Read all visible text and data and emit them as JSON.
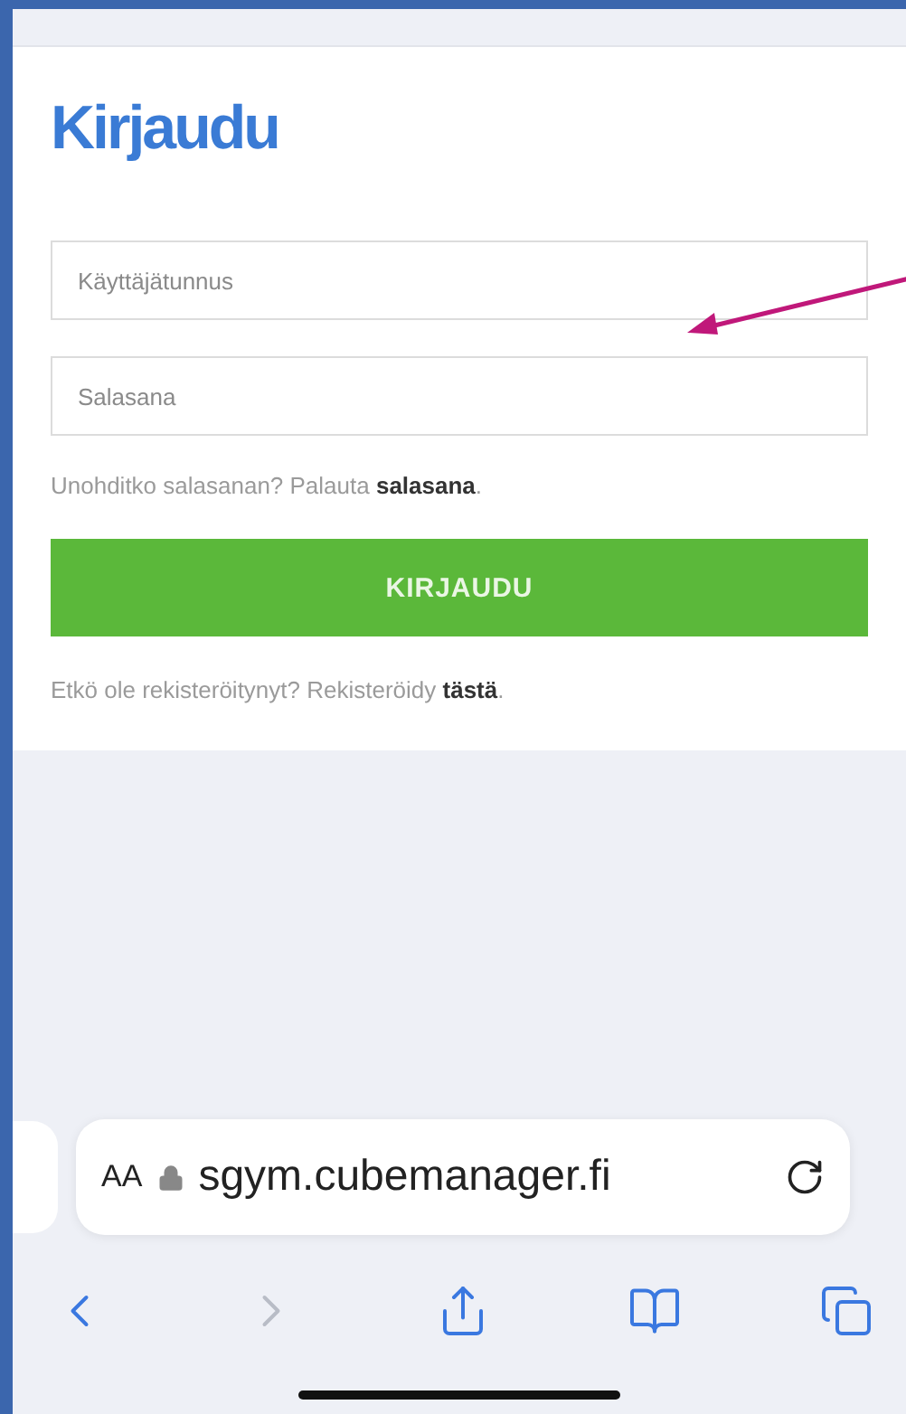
{
  "login": {
    "title": "Kirjaudu",
    "fields": [
      {
        "placeholder": "Käyttäjätunnus"
      },
      {
        "placeholder": "Salasana"
      }
    ],
    "forgot": {
      "text": "Unohditko salasanan? Palauta ",
      "link": "salasana",
      "after": "."
    },
    "button": "KIRJAUDU",
    "register": {
      "text": "Etkö ole rekisteröitynyt? Rekisteröidy ",
      "link": "tästä",
      "after": "."
    }
  },
  "browser": {
    "text_size": "AA",
    "url": "sgym.cubemanager.fi",
    "toolbar": [
      {
        "kind": "back",
        "disabled": false
      },
      {
        "kind": "forward",
        "disabled": true
      },
      {
        "kind": "share",
        "disabled": false
      },
      {
        "kind": "bookmarks",
        "disabled": false
      },
      {
        "kind": "tabs",
        "disabled": false
      }
    ]
  }
}
